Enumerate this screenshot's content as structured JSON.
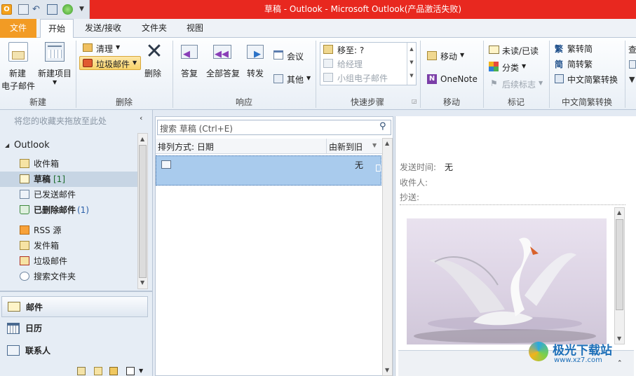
{
  "window": {
    "title": "草稿 - Outlook - Microsoft Outlook(产品激活失败)"
  },
  "tabs": [
    {
      "label": "文件"
    },
    {
      "label": "开始"
    },
    {
      "label": "发送/接收"
    },
    {
      "label": "文件夹"
    },
    {
      "label": "视图"
    }
  ],
  "ribbon": {
    "new_group": {
      "label": "新建",
      "new_email_l1": "新建",
      "new_email_l2": "电子邮件",
      "new_item": "新建项目"
    },
    "delete_group": {
      "label": "删除",
      "cleanup": "清理",
      "junk": "垃圾邮件",
      "delete": "删除"
    },
    "respond_group": {
      "label": "响应",
      "reply": "答复",
      "reply_all": "全部答复",
      "forward": "转发",
      "meeting": "会议",
      "more": "其他"
    },
    "quicksteps_group": {
      "label": "快速步骤",
      "move_to": "移至: ?",
      "to_manager": "给经理",
      "team_email": "小组电子邮件"
    },
    "move_group": {
      "label": "移动",
      "move": "移动",
      "onenote": "OneNote"
    },
    "tags_group": {
      "label": "标记",
      "unread_read": "未读/已读",
      "categorize": "分类",
      "follow_up": "后续标志"
    },
    "chinese_group": {
      "label": "中文简繁转换",
      "to_traditional": "繁转简",
      "to_simplified": "简转繁",
      "convert": "中文简繁转换"
    },
    "find_partial": "查"
  },
  "nav": {
    "favorites_hint": "将您的收藏夹拖放至此处",
    "account": "Outlook",
    "folders": [
      {
        "label": "收件箱",
        "count": ""
      },
      {
        "label": "草稿",
        "count": "[1]"
      },
      {
        "label": "已发送邮件",
        "count": ""
      },
      {
        "label": "已删除邮件",
        "count": "(1)"
      },
      {
        "label": "RSS 源",
        "count": ""
      },
      {
        "label": "发件箱",
        "count": ""
      },
      {
        "label": "垃圾邮件",
        "count": ""
      },
      {
        "label": "搜索文件夹",
        "count": ""
      }
    ],
    "modules": [
      {
        "label": "邮件"
      },
      {
        "label": "日历"
      },
      {
        "label": "联系人"
      }
    ]
  },
  "list": {
    "search_placeholder": "搜索 草稿 (Ctrl+E)",
    "sort_label": "排列方式: 日期",
    "sort_order": "由新到旧",
    "items": [
      {
        "date": "无"
      }
    ]
  },
  "reading": {
    "sent_label": "发送时间:",
    "sent_value": "无",
    "to_label": "收件人:",
    "cc_label": "抄送:"
  },
  "watermark": {
    "text": "极光下载站",
    "url": "www.xz7.com"
  }
}
